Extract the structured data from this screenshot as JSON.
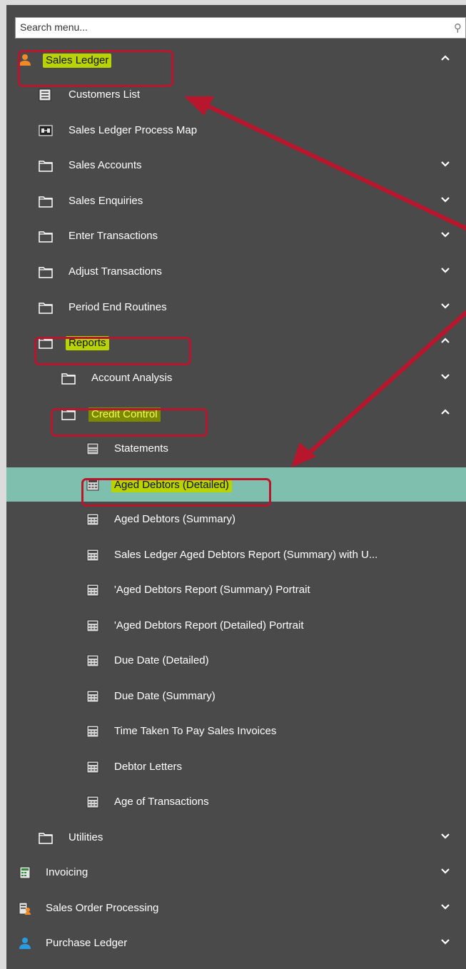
{
  "search": {
    "placeholder": "Search menu..."
  },
  "colors": {
    "panel": "#4a4a4b",
    "selected_row": "#7ebfad",
    "highlight": "#b8d300",
    "annotation_red": "#b8162c"
  },
  "menu": [
    {
      "id": "sales-ledger",
      "label": "Sales Ledger",
      "icon": "person-orange-icon",
      "chevron": "up",
      "level": 0
    },
    {
      "id": "customers-list",
      "label": "Customers List",
      "icon": "list-icon",
      "chevron": "",
      "level": 1
    },
    {
      "id": "process-map",
      "label": "Sales Ledger Process Map",
      "icon": "process-map-icon",
      "chevron": "",
      "level": 1
    },
    {
      "id": "sales-accounts",
      "label": "Sales Accounts",
      "icon": "folder-icon",
      "chevron": "down",
      "level": 1
    },
    {
      "id": "sales-enquiries",
      "label": "Sales Enquiries",
      "icon": "folder-icon",
      "chevron": "down",
      "level": 1
    },
    {
      "id": "enter-transactions",
      "label": "Enter Transactions",
      "icon": "folder-icon",
      "chevron": "down",
      "level": 1
    },
    {
      "id": "adjust-transactions",
      "label": "Adjust Transactions",
      "icon": "folder-icon",
      "chevron": "down",
      "level": 1
    },
    {
      "id": "period-end",
      "label": "Period End Routines",
      "icon": "folder-icon",
      "chevron": "down",
      "level": 1
    },
    {
      "id": "reports",
      "label": "Reports",
      "icon": "folder-icon",
      "chevron": "up",
      "level": 1
    },
    {
      "id": "account-analysis",
      "label": "Account Analysis",
      "icon": "folder-icon",
      "chevron": "down",
      "level": 2
    },
    {
      "id": "credit-control",
      "label": "Credit Control",
      "icon": "folder-icon",
      "chevron": "up",
      "level": 2
    },
    {
      "id": "statements",
      "label": "Statements",
      "icon": "statement-icon",
      "chevron": "",
      "level": 3
    },
    {
      "id": "aged-debtors-detailed",
      "label": "Aged Debtors (Detailed)",
      "icon": "report-icon",
      "chevron": "",
      "level": 3
    },
    {
      "id": "aged-debtors-summary",
      "label": "Aged Debtors (Summary)",
      "icon": "report-icon",
      "chevron": "",
      "level": 3
    },
    {
      "id": "sl-aged-debtors-summary-u",
      "label": "Sales Ledger Aged Debtors Report (Summary) with U...",
      "icon": "report-icon",
      "chevron": "",
      "level": 3
    },
    {
      "id": "aged-summary-portrait",
      "label": "'Aged Debtors Report (Summary) Portrait",
      "icon": "report-icon",
      "chevron": "",
      "level": 3
    },
    {
      "id": "aged-detailed-portrait",
      "label": "'Aged Debtors Report (Detailed) Portrait",
      "icon": "report-icon",
      "chevron": "",
      "level": 3
    },
    {
      "id": "due-date-detailed",
      "label": "Due Date (Detailed)",
      "icon": "report-icon",
      "chevron": "",
      "level": 3
    },
    {
      "id": "due-date-summary",
      "label": "Due Date (Summary)",
      "icon": "report-icon",
      "chevron": "",
      "level": 3
    },
    {
      "id": "time-taken",
      "label": "Time Taken To Pay Sales Invoices",
      "icon": "report-icon",
      "chevron": "",
      "level": 3
    },
    {
      "id": "debtor-letters",
      "label": "Debtor Letters",
      "icon": "report-icon",
      "chevron": "",
      "level": 3
    },
    {
      "id": "age-of-transactions",
      "label": "Age of Transactions",
      "icon": "report-icon",
      "chevron": "",
      "level": 3
    },
    {
      "id": "utilities",
      "label": "Utilities",
      "icon": "folder-icon",
      "chevron": "down",
      "level": 1
    },
    {
      "id": "invoicing",
      "label": "Invoicing",
      "icon": "invoice-green-icon",
      "chevron": "down",
      "level": 0
    },
    {
      "id": "sales-order-processing",
      "label": "Sales Order Processing",
      "icon": "sales-order-icon",
      "chevron": "down",
      "level": 0
    },
    {
      "id": "purchase-ledger",
      "label": "Purchase Ledger",
      "icon": "person-blue-icon",
      "chevron": "down",
      "level": 0
    }
  ]
}
